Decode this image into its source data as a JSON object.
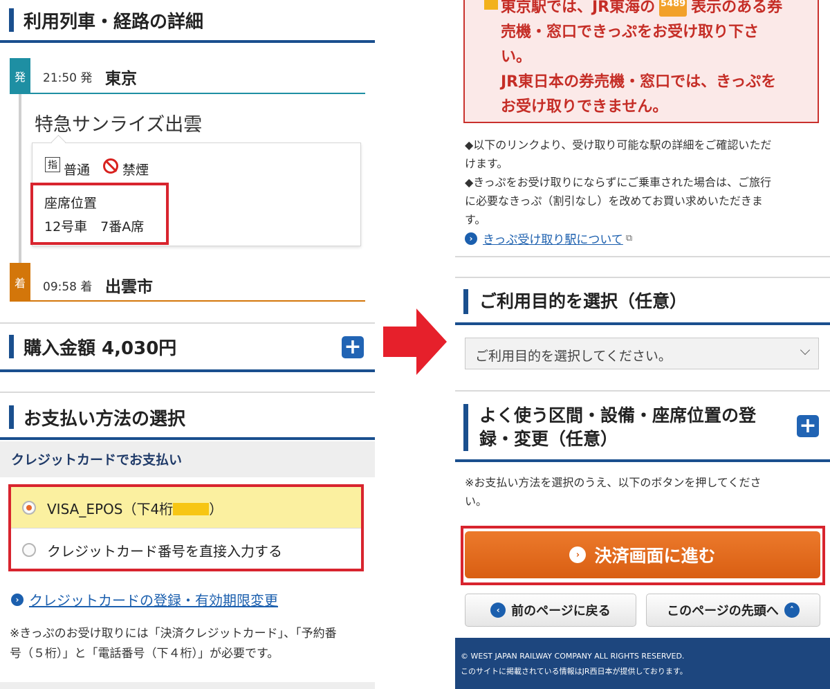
{
  "left": {
    "route_section_title": "利用列車・経路の詳細",
    "departure": {
      "tag": "発",
      "time": "21:50 発",
      "station": "東京"
    },
    "train_name": "特急サンライズ出雲",
    "seat_card": {
      "reserved_icon": "指",
      "car_class": "普通",
      "smoking": "禁煙",
      "seat_label": "座席位置",
      "seat_value": "12号車　7番A席"
    },
    "arrival": {
      "tag": "着",
      "time": "09:58 着",
      "station": "出雲市"
    },
    "price_title": "購入金額 4,030円",
    "payment_title": "お支払い方法の選択",
    "credit_band": "クレジットカードでお支払い",
    "options": [
      {
        "label_prefix": "VISA_EPOS（下4桁",
        "label_suffix": "）",
        "selected": true
      },
      {
        "label": "クレジットカード番号を直接入力する",
        "selected": false
      }
    ],
    "card_link": "クレジットカードの登録・有効期限変更",
    "note_line1": "※きっぷのお受け取りには「決済クレジットカード」、「予約番",
    "note_line2": "号（５桁）」と「電話番号（下４桁）」が必要です。"
  },
  "right": {
    "notice": {
      "line1_a": "東京駅では、JR東海の",
      "badge": "5489",
      "line1_b": "表示のある券",
      "line2": "売機・窓口できっぷをお受け取り下さ",
      "line3": "い。",
      "line4": "JR東日本の券売機・窓口では、きっぷを",
      "line5": "お受け取りできません。"
    },
    "info_line1": "◆以下のリンクより、受け取り可能な駅の詳細をご確認いただ",
    "info_line2": "けます。",
    "info_line3": "◆きっぷをお受け取りにならずにご乗車された場合は、ご旅行",
    "info_line4": "に必要なきっぷ（割引なし）を改めてお買い求めいただきま",
    "info_line5": "す。",
    "pickup_link": "きっぷ受け取り駅について",
    "purpose_title": "ご利用目的を選択（任意）",
    "purpose_select": "ご利用目的を選択してください。",
    "register_title_1": "よく使う区間・設備・座席位置の登",
    "register_title_2": "録・変更（任意）",
    "pay_note_1": "※お支払い方法を選択のうえ、以下のボタンを押してくださ",
    "pay_note_2": "い。",
    "pay_button": "決済画面に進む",
    "back_button": "前のページに戻る",
    "top_button": "このページの先頭へ",
    "footer_1": "© WEST JAPAN RAILWAY COMPANY ALL RIGHTS RESERVED.",
    "footer_2": "このサイトに掲載されている情報はJR西日本が提供しております。"
  },
  "colors": {
    "brand_blue": "#1a4f8e",
    "highlight_red": "#d8242e",
    "arrow_red": "#e6202b",
    "pay_orange": "#e06a1e",
    "departure_teal": "#1e8fa3",
    "arrival_orange": "#d3760a",
    "selected_row": "#fbf0a0"
  }
}
